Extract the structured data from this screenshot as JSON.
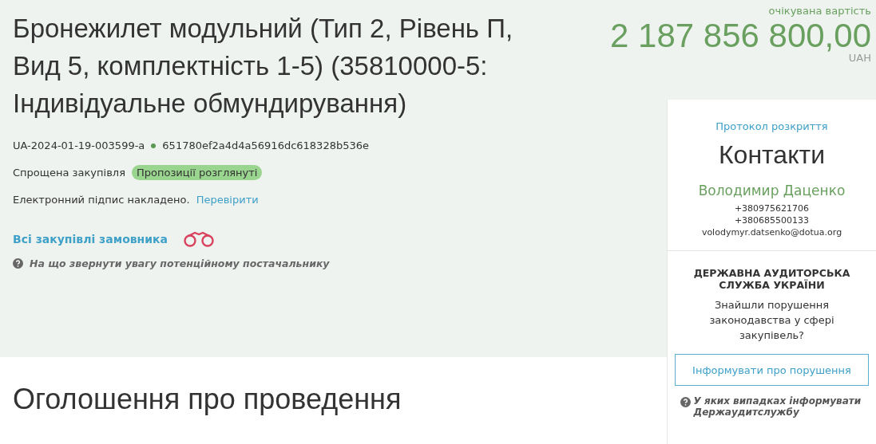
{
  "tender": {
    "title": "Бронежилет модульний (Тип 2, Рівень П, Вид 5, комплектність 1-5) (35810000-5: Індивідуальне обмундирування)",
    "id": "UA-2024-01-19-003599-a",
    "hash": "651780ef2a4d4a56916dc618328b536e",
    "procedure": "Спрощена закупівля",
    "status": {
      "label": "Пропозиції розглянуті",
      "color": "#9ad58f"
    },
    "signature": {
      "text": "Електронний підпис накладено.",
      "link": "Перевірити"
    },
    "all_purchases_link": "Всі закупівлі замовника",
    "hint": "На що звернути увагу потенційному постачальнику"
  },
  "price": {
    "label": "очікувана вартість",
    "amount": "2 187 856 800,00",
    "currency": "UAH"
  },
  "sidebar": {
    "protocol_link": "Протокол розкриття",
    "contacts_title": "Контакти",
    "contact_name": "Володимир Даценко",
    "contact_lines": [
      "+380975621706",
      "+380685500133",
      "volodymyr.datsenko@dotua.org"
    ],
    "audit_title": "ДЕРЖАВНА АУДИТОРСЬКА СЛУЖБА УКРАЇНИ",
    "audit_question": "Знайшли порушення законодавства у сфері закупівель?",
    "report_button": "Інформувати про порушення",
    "audit_hint": "У яких випадках інформувати Держаудитслужбу"
  },
  "section_title": "Оголошення про проведення"
}
